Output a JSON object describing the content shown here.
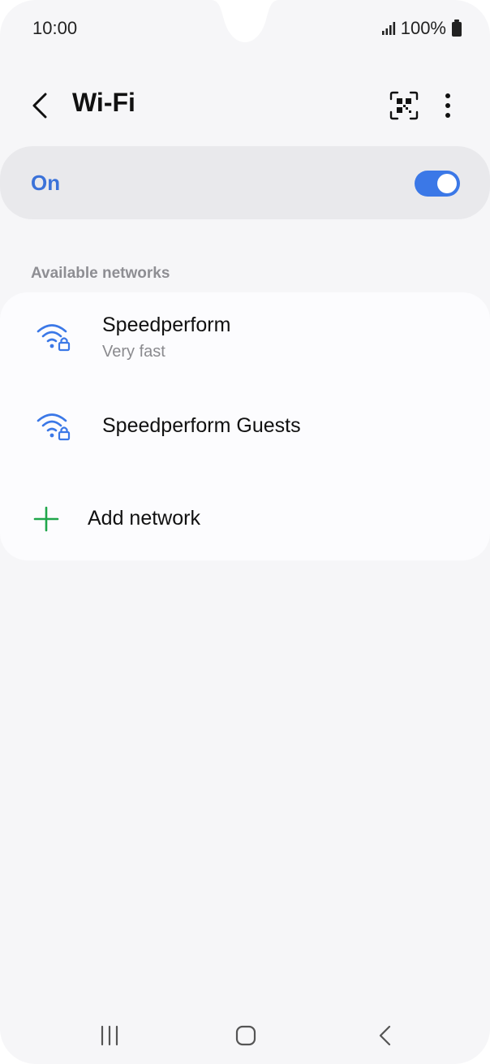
{
  "status": {
    "time": "10:00",
    "battery": "100%"
  },
  "header": {
    "title": "Wi-Fi"
  },
  "wifi_toggle": {
    "label": "On",
    "enabled": true,
    "accent": "#3b78e7"
  },
  "networks": {
    "section_label": "Available networks",
    "items": [
      {
        "name": "Speedperform",
        "subtitle": "Very fast",
        "secured": true
      },
      {
        "name": "Speedperform Guests",
        "subtitle": "",
        "secured": true
      }
    ],
    "add_label": "Add network"
  },
  "icons": {
    "back": "chevron-left-icon",
    "qr": "qr-scan-icon",
    "more": "more-vertical-icon",
    "wifi": "wifi-lock-icon",
    "add": "plus-icon"
  },
  "colors": {
    "wifi_icon": "#3b78e7",
    "plus_icon": "#1fa64a",
    "background": "#f6f6f8"
  }
}
